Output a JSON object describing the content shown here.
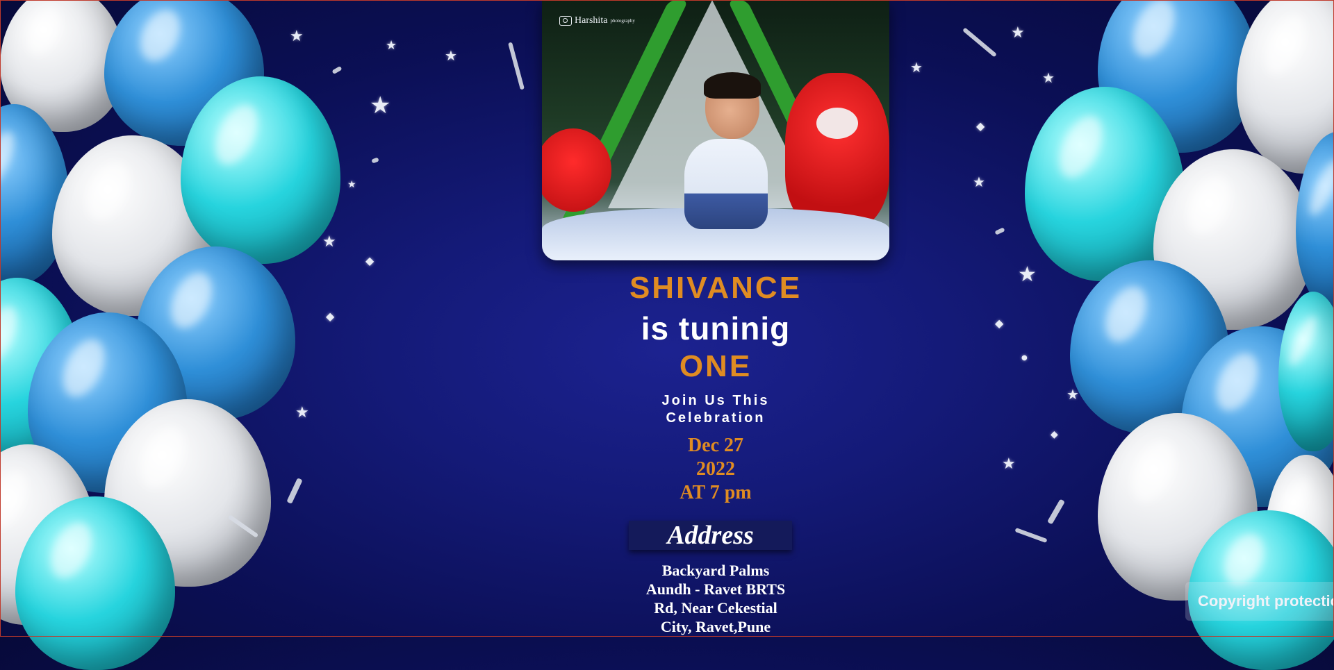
{
  "photo": {
    "studio_logo": "Harshita",
    "studio_logo_sub": "photography"
  },
  "invitation": {
    "name": "SHIVANCE",
    "tagline": "is tuninig",
    "age": "ONE",
    "join_line1": "Join Us This",
    "join_line2": "Celebration",
    "date_line1": "Dec 27",
    "date_line2": "2022",
    "time_line": "AT 7 pm",
    "address_heading": "Address",
    "address_lines": [
      "Backyard Palms",
      "Aundh - Ravet BRTS",
      "Rd, Near Cekestial",
      "City, Ravet,Pune"
    ]
  },
  "overlay": {
    "copyright_label": "Copyright protection"
  },
  "colors": {
    "background": "#0b0f55",
    "accent_orange": "#e08c22",
    "text_white": "#ffffff"
  },
  "icons": {
    "camera": "camera-icon",
    "star": "star-icon"
  }
}
